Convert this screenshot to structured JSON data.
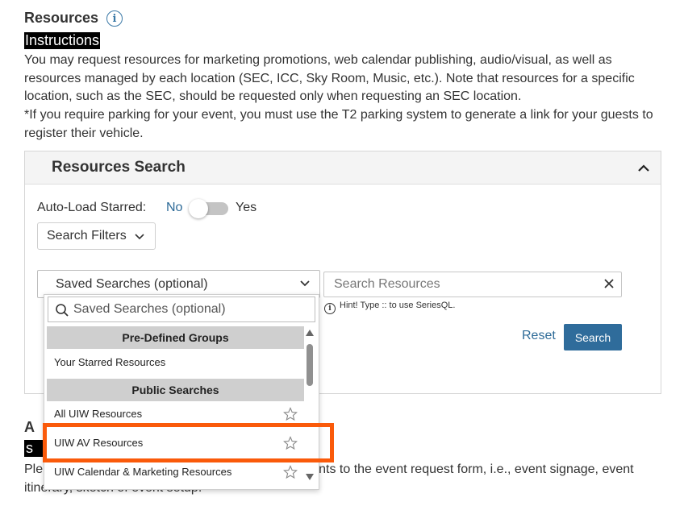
{
  "header": {
    "title": "Resources",
    "info_glyph": "i",
    "instructions_label": "Instructions",
    "para1": "You may request resources for marketing promotions, web calendar publishing, audio/visual, as well as resources managed by each location (SEC, ICC, Sky Room, Music, etc.). Note that resources for a specific location, such as the SEC, should be requested only when requesting an SEC location.",
    "para2": "*If you require parking for your event, you must use the T2 parking system to generate a link for your guests to register their vehicle."
  },
  "panel": {
    "title": "Resources Search",
    "autoload_label": "Auto-Load Starred:",
    "toggle_no": "No",
    "toggle_yes": "Yes",
    "filters_label": "Search Filters",
    "saved_searches_label": "Saved Searches (optional)",
    "search_placeholder": "Search Resources",
    "hint_glyph": "i",
    "hint": "Hint! Type :: to use SeriesQL.",
    "reset_label": "Reset",
    "search_label": "Search"
  },
  "below": {
    "heading_fragment": "A",
    "label_fragment": "s",
    "para_line1_left": "Ple",
    "para_line1_right": "nts to the event request form, i.e., event signage, event",
    "para_line2": "itinerary, sketch of event setup."
  },
  "dropdown": {
    "search_placeholder": "Saved Searches (optional)",
    "groups": [
      "Pre-Defined Groups",
      "Public Searches"
    ],
    "predefined_items": [
      "Your Starred Resources"
    ],
    "public_items": [
      "All UIW Resources",
      "UIW AV Resources",
      "UIW Calendar & Marketing Resources"
    ]
  },
  "colors": {
    "accent": "#2f6c9b",
    "link": "#2e6b98",
    "highlight": "#fa5a0a"
  }
}
